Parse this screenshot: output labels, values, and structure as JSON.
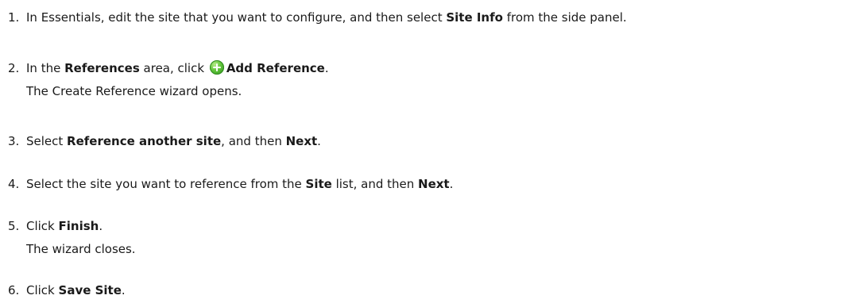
{
  "steps": [
    {
      "num": "1.",
      "parts": [
        "In Essentials, edit the site that you want to configure, and then select ",
        "Site Info",
        " from the side panel."
      ]
    },
    {
      "num": "2.",
      "parts": [
        "In the ",
        "References",
        " area, click ",
        "Add Reference",
        "."
      ],
      "note": "The Create Reference wizard opens."
    },
    {
      "num": "3.",
      "parts": [
        "Select ",
        "Reference another site",
        ", and then ",
        "Next",
        "."
      ]
    },
    {
      "num": "4.",
      "parts": [
        "Select the site you want to reference from the ",
        "Site",
        " list, and then ",
        "Next",
        "."
      ]
    },
    {
      "num": "5.",
      "parts": [
        "Click ",
        "Finish",
        "."
      ],
      "note": "The wizard closes."
    },
    {
      "num": "6.",
      "parts": [
        "Click ",
        "Save Site",
        "."
      ]
    }
  ],
  "icons": {
    "add_reference": "plus-circle-icon",
    "add_reference_color": "#4cb52e"
  }
}
